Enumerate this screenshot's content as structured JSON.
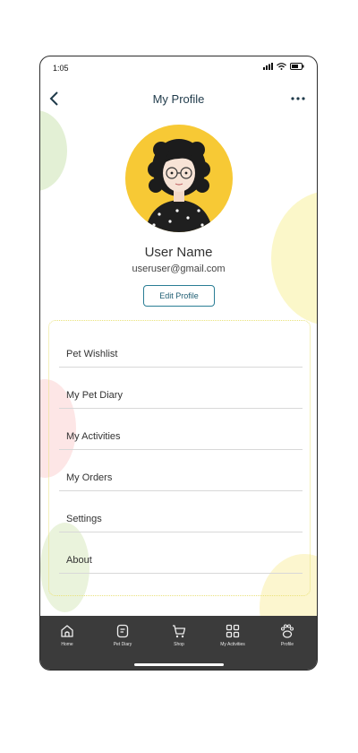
{
  "status_bar": {
    "time": "1:05"
  },
  "header": {
    "title": "My Profile"
  },
  "profile": {
    "name": "User Name",
    "email": "useruser@gmail.com",
    "edit_label": "Edit Profile"
  },
  "menu": {
    "items": [
      {
        "label": "Pet Wishlist"
      },
      {
        "label": "My Pet Diary"
      },
      {
        "label": "My Activities"
      },
      {
        "label": "My Orders"
      },
      {
        "label": "Settings"
      },
      {
        "label": "About"
      }
    ]
  },
  "tabs": [
    {
      "label": "Home",
      "icon": "home-icon"
    },
    {
      "label": "Pet Diary",
      "icon": "diary-icon"
    },
    {
      "label": "Shop",
      "icon": "cart-icon"
    },
    {
      "label": "My Activities",
      "icon": "grid-icon"
    },
    {
      "label": "Profile",
      "icon": "paw-icon"
    }
  ],
  "colors": {
    "accent": "#2a7d95",
    "avatar_bg": "#f7c935",
    "tab_bar": "#3b3b3b"
  }
}
